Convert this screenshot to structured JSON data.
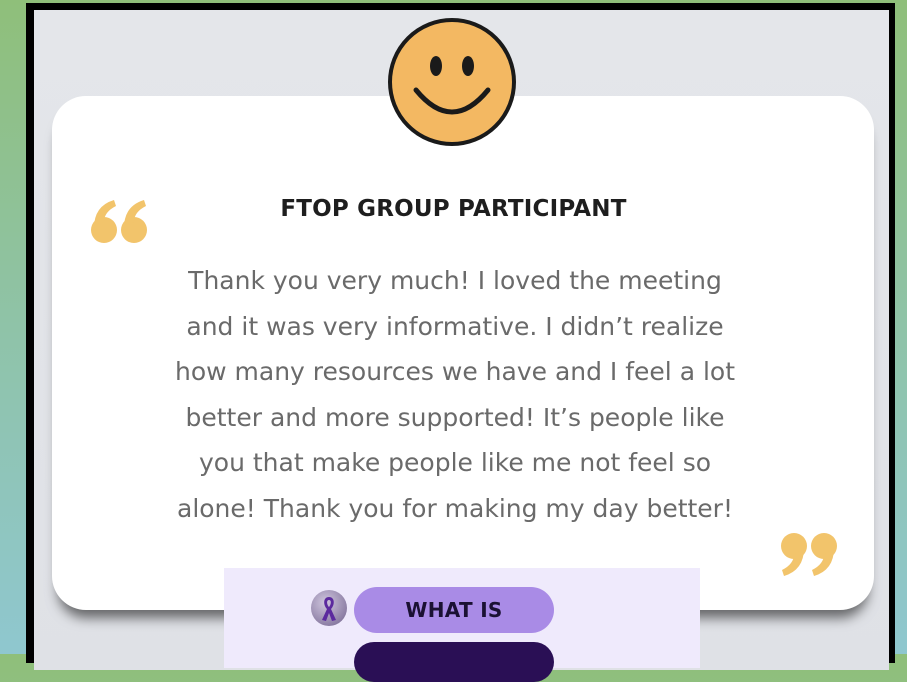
{
  "testimonial": {
    "heading": "FTOP GROUP PARTICIPANT",
    "lines": [
      "Thank you very much! I loved the meeting",
      "and it was very informative. I didn’t realize",
      "how many resources we have and I feel a lot",
      "better and more supported! It’s people like",
      "you that make people like me not feel so",
      "alone! Thank you for making my day better!"
    ],
    "icon": "smiley-face-icon",
    "quote_color": "#f2c46b",
    "smiley_color": "#f3b862"
  },
  "overlay": {
    "button_label": "WHAT IS",
    "badge_icon": "awareness-ribbon-icon",
    "button_color": "#a98be6",
    "button_dark_color": "#2a0f55"
  }
}
